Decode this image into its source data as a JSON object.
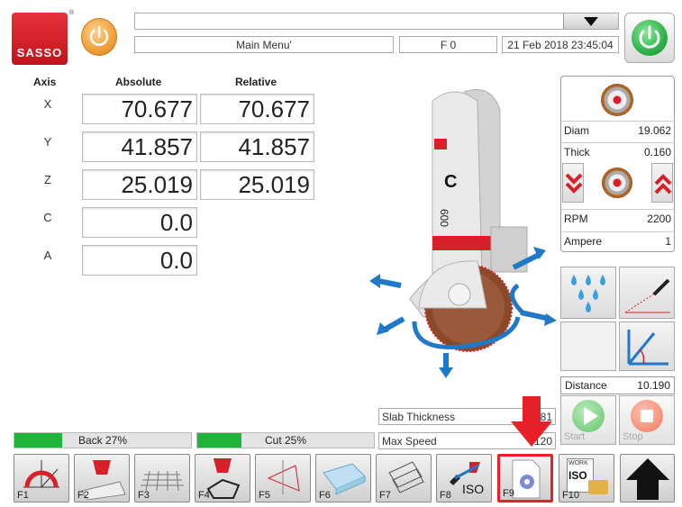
{
  "header": {
    "logo_text": "SASSO",
    "menu_title": "Main Menu'",
    "feed": "F 0",
    "datetime": "21 Feb 2018 23:45:04"
  },
  "axes": {
    "col_axis": "Axis",
    "col_absolute": "Absolute",
    "col_relative": "Relative",
    "rows": [
      {
        "name": "X",
        "absolute": "70.677",
        "relative": "70.677"
      },
      {
        "name": "Y",
        "absolute": "41.857",
        "relative": "41.857"
      },
      {
        "name": "Z",
        "absolute": "25.019",
        "relative": "25.019"
      },
      {
        "name": "C",
        "absolute": "0.0"
      },
      {
        "name": "A",
        "absolute": "0.0"
      }
    ]
  },
  "machine": {
    "head_letter": "C",
    "head_number": "600"
  },
  "blade_panel": {
    "diam_label": "Diam",
    "diam_value": "19.062",
    "thick_label": "Thick",
    "thick_value": "0.160",
    "rpm_label": "RPM",
    "rpm_value": "2200",
    "ampere_label": "Ampere",
    "ampere_value": "1"
  },
  "distance": {
    "label": "Distance",
    "value": "10.190"
  },
  "info_fields": [
    {
      "label": "Slab Thickness",
      "value": "181"
    },
    {
      "label": "Max Speed",
      "value": "120"
    }
  ],
  "buttons": {
    "start": "Start",
    "stop": "Stop"
  },
  "progress": [
    {
      "label": "Back 27%",
      "percent": 27
    },
    {
      "label": "Cut 25%",
      "percent": 25
    }
  ],
  "fkeys": [
    "F1",
    "F2",
    "F3",
    "F4",
    "F5",
    "F6",
    "F7",
    "F8",
    "F9",
    "F10"
  ],
  "fkey_texts": {
    "f8_iso": "ISO",
    "f10_work": "WORK",
    "f10_iso": "ISO"
  },
  "colors": {
    "accent_red": "#d8202a",
    "power_green": "#2fb24a",
    "power_orange": "#f2a03a",
    "progress_green": "#1fb53b",
    "arrow_blue": "#1f78c8"
  }
}
